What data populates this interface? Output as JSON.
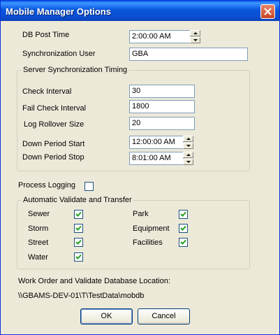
{
  "window": {
    "title": "Mobile Manager Options"
  },
  "fields": {
    "db_post_time": {
      "label": "DB Post Time",
      "value": "2:00:00 AM"
    },
    "sync_user": {
      "label": "Synchronization User",
      "value": "GBA"
    }
  },
  "server_sync": {
    "title": "Server Synchronization Timing",
    "check_interval": {
      "label": "Check Interval",
      "value": "30"
    },
    "fail_check_interval": {
      "label": "Fail Check Interval",
      "value": "1800"
    },
    "log_rollover_size": {
      "label": "Log Rollover Size",
      "value": "20"
    },
    "down_period_start": {
      "label": "Down Period Start",
      "value": "12:00:00 AM"
    },
    "down_period_stop": {
      "label": "Down Period Stop",
      "value": "8:01:00 AM"
    }
  },
  "process_logging": {
    "label": "Process Logging",
    "checked": false
  },
  "auto_validate": {
    "title": "Automatic Validate and Transfer",
    "items": [
      {
        "label": "Sewer",
        "checked": true
      },
      {
        "label": "Storm",
        "checked": true
      },
      {
        "label": "Street",
        "checked": true
      },
      {
        "label": "Water",
        "checked": true
      },
      {
        "label": "Park",
        "checked": true
      },
      {
        "label": "Equipment",
        "checked": true
      },
      {
        "label": "Facilities",
        "checked": true
      }
    ]
  },
  "db_location": {
    "label": "Work Order and Validate Database Location:",
    "path": "\\\\GBAMS-DEV-01\\T\\TestData\\mobdb"
  },
  "buttons": {
    "ok": "OK",
    "cancel": "Cancel"
  }
}
